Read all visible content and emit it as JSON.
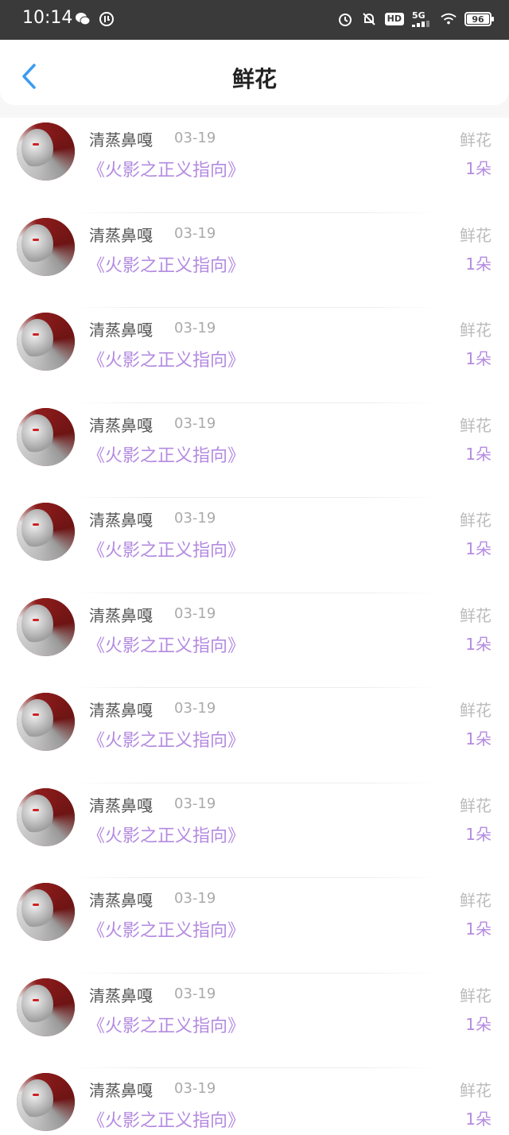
{
  "status_bar": {
    "time": "10:14",
    "left_icons": [
      "wechat-icon",
      "app-badge-icon"
    ],
    "right_icons": [
      "alarm-icon",
      "mute-bell-icon",
      "hd-icon",
      "signal-5g-icon",
      "wifi-icon",
      "battery-icon"
    ],
    "hd_label": "HD",
    "network_label": "5G",
    "battery_level": "96"
  },
  "header": {
    "title": "鲜花",
    "back_icon": "chevron-left-icon",
    "accent_color": "#3b9cf0"
  },
  "colors": {
    "accent_purple": "#b48be0",
    "name_gray": "#555555",
    "meta_gray": "#aaaaaa"
  },
  "items": [
    {
      "name": "清蒸鼻嘎",
      "date": "03-19",
      "work": "《火影之正义指向》",
      "gift": "鲜花",
      "amount": "1朵"
    },
    {
      "name": "清蒸鼻嘎",
      "date": "03-19",
      "work": "《火影之正义指向》",
      "gift": "鲜花",
      "amount": "1朵"
    },
    {
      "name": "清蒸鼻嘎",
      "date": "03-19",
      "work": "《火影之正义指向》",
      "gift": "鲜花",
      "amount": "1朵"
    },
    {
      "name": "清蒸鼻嘎",
      "date": "03-19",
      "work": "《火影之正义指向》",
      "gift": "鲜花",
      "amount": "1朵"
    },
    {
      "name": "清蒸鼻嘎",
      "date": "03-19",
      "work": "《火影之正义指向》",
      "gift": "鲜花",
      "amount": "1朵"
    },
    {
      "name": "清蒸鼻嘎",
      "date": "03-19",
      "work": "《火影之正义指向》",
      "gift": "鲜花",
      "amount": "1朵"
    },
    {
      "name": "清蒸鼻嘎",
      "date": "03-19",
      "work": "《火影之正义指向》",
      "gift": "鲜花",
      "amount": "1朵"
    },
    {
      "name": "清蒸鼻嘎",
      "date": "03-19",
      "work": "《火影之正义指向》",
      "gift": "鲜花",
      "amount": "1朵"
    },
    {
      "name": "清蒸鼻嘎",
      "date": "03-19",
      "work": "《火影之正义指向》",
      "gift": "鲜花",
      "amount": "1朵"
    },
    {
      "name": "清蒸鼻嘎",
      "date": "03-19",
      "work": "《火影之正义指向》",
      "gift": "鲜花",
      "amount": "1朵"
    },
    {
      "name": "清蒸鼻嘎",
      "date": "03-19",
      "work": "《火影之正义指向》",
      "gift": "鲜花",
      "amount": "1朵"
    }
  ]
}
